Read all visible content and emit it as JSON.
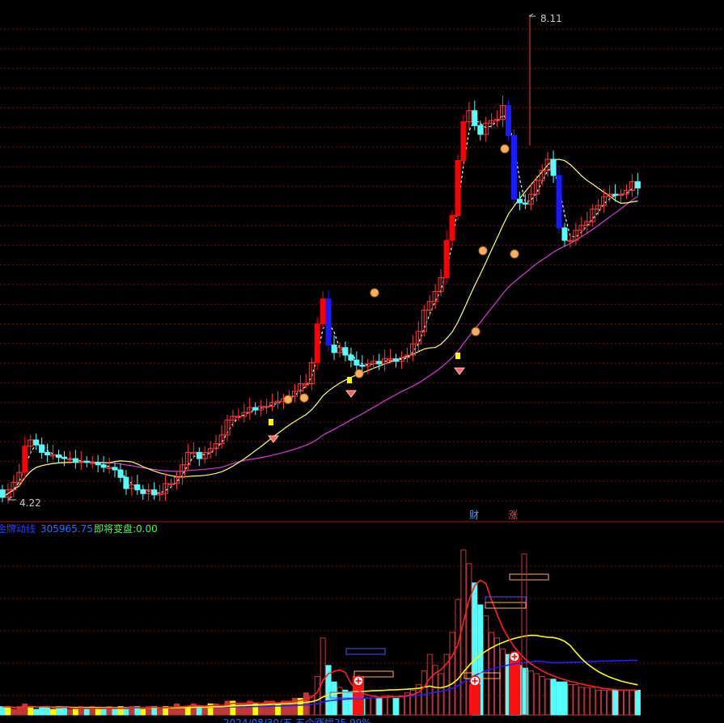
{
  "colors": {
    "background": "#000000",
    "grid": "#7a1010",
    "separator": "#a01818",
    "up": "#ff3b3b",
    "down": "#54ffff",
    "strong_up": "#ff0000",
    "strong_down": "#1a1aff",
    "price_trend": "#ffffff",
    "ma_short": "#ffff70",
    "ma_long": "#d040d0",
    "vol_ma_red": "#ff2020",
    "vol_ma_yellow": "#ffff00",
    "vol_ma_blue": "#2020ff",
    "text_gray": "#c8c8c8"
  },
  "main_chart": {
    "high_label": "8.11",
    "low_label": "4.22",
    "markers": [
      {
        "text": "财",
        "color": "#4a9dff"
      },
      {
        "text": "涨",
        "color": "#ff4040"
      }
    ]
  },
  "indicator": {
    "name": "金牌动线",
    "value": "305965.75",
    "label2": "即将变盘:",
    "value2": "0.00"
  },
  "bottom_text": "2024/08/30/五 五个涨幅25.99%",
  "chart_data": [
    {
      "type": "candlestick",
      "x": [
        0,
        1,
        2,
        3,
        4,
        5,
        6,
        7,
        8,
        9,
        10,
        11,
        12,
        13,
        14,
        15,
        16,
        17,
        18,
        19,
        20,
        21,
        22,
        23,
        24,
        25,
        26,
        27,
        28,
        29,
        30,
        31,
        32,
        33,
        34,
        35,
        36,
        37,
        38,
        39,
        40,
        41,
        42,
        43,
        44,
        45,
        46,
        47,
        48,
        49,
        50,
        51,
        52,
        53,
        54,
        55,
        56,
        57,
        58,
        59,
        60,
        61,
        62,
        63,
        64,
        65,
        66,
        67,
        68,
        69,
        70,
        71,
        72,
        73,
        74,
        75,
        76,
        77,
        78,
        79,
        80,
        81,
        82,
        83,
        84,
        85,
        86,
        87,
        88,
        89,
        90,
        91,
        92,
        93,
        94,
        95,
        96,
        97,
        98,
        99,
        100,
        101,
        102,
        103,
        104,
        105,
        106,
        107,
        108,
        109,
        110,
        111,
        112,
        113,
        114,
        115,
        116,
        117,
        118,
        119,
        120,
        121,
        122,
        123,
        124,
        125,
        126,
        127,
        128,
        129
      ],
      "open": [
        4.3,
        4.24,
        4.3,
        4.36,
        4.44,
        4.65,
        4.7,
        4.66,
        4.6,
        4.58,
        4.58,
        4.56,
        4.55,
        4.55,
        4.52,
        4.53,
        4.52,
        4.52,
        4.5,
        4.48,
        4.48,
        4.46,
        4.4,
        4.31,
        4.34,
        4.3,
        4.27,
        4.3,
        4.26,
        4.27,
        4.35,
        4.35,
        4.4,
        4.5,
        4.6,
        4.6,
        4.55,
        4.6,
        4.63,
        4.67,
        4.74,
        4.86,
        4.89,
        4.89,
        4.92,
        4.96,
        4.94,
        4.97,
        4.97,
        5.0,
        5.01,
        5.03,
        5.05,
        5.09,
        5.15,
        5.15,
        5.32,
        5.63,
        5.83,
        5.46,
        5.4,
        5.44,
        5.38,
        5.34,
        5.3,
        5.29,
        5.31,
        5.33,
        5.31,
        5.35,
        5.35,
        5.33,
        5.36,
        5.38,
        5.47,
        5.57,
        5.74,
        5.81,
        5.89,
        6.0,
        6.3,
        6.5,
        6.94,
        7.25,
        7.34,
        7.22,
        7.15,
        7.24,
        7.26,
        7.27,
        7.38,
        7.14,
        6.63,
        6.6,
        6.59,
        6.67,
        6.78,
        6.86,
        6.95,
        6.82,
        6.4,
        6.3,
        6.3,
        6.38,
        6.42,
        6.45,
        6.55,
        6.58,
        6.65,
        6.67,
        6.66,
        6.67,
        6.7,
        6.77
      ],
      "close": [
        4.24,
        4.3,
        4.36,
        4.44,
        4.65,
        4.7,
        4.66,
        4.6,
        4.58,
        4.58,
        4.56,
        4.55,
        4.55,
        4.52,
        4.53,
        4.52,
        4.52,
        4.5,
        4.48,
        4.48,
        4.46,
        4.4,
        4.31,
        4.34,
        4.3,
        4.27,
        4.3,
        4.26,
        4.27,
        4.35,
        4.35,
        4.4,
        4.5,
        4.6,
        4.6,
        4.55,
        4.6,
        4.63,
        4.67,
        4.74,
        4.86,
        4.89,
        4.89,
        4.92,
        4.96,
        4.94,
        4.97,
        4.97,
        5.0,
        5.01,
        5.03,
        5.05,
        5.09,
        5.15,
        5.15,
        5.32,
        5.63,
        5.83,
        5.46,
        5.4,
        5.44,
        5.38,
        5.34,
        5.3,
        5.29,
        5.31,
        5.33,
        5.31,
        5.35,
        5.35,
        5.33,
        5.36,
        5.38,
        5.47,
        5.57,
        5.74,
        5.81,
        5.89,
        6.0,
        6.3,
        6.5,
        6.94,
        7.25,
        7.34,
        7.22,
        7.15,
        7.24,
        7.26,
        7.27,
        7.38,
        7.14,
        6.63,
        6.6,
        6.59,
        6.67,
        6.78,
        6.86,
        6.95,
        6.82,
        6.4,
        6.3,
        6.3,
        6.38,
        6.42,
        6.45,
        6.55,
        6.58,
        6.65,
        6.67,
        6.66,
        6.67,
        6.7,
        6.77,
        6.72
      ],
      "note": "approximate daily OHLC read from the price panel; ranges from low 4.22 to high 8.11"
    },
    {
      "type": "bar",
      "name": "volume",
      "note": "relative volume bars in lower panel; largest bars around the 8.11 peak",
      "values": [
        3,
        3,
        2,
        3,
        4,
        3,
        2,
        3,
        3,
        2,
        3,
        3,
        2,
        2,
        3,
        2,
        3,
        2,
        2,
        3,
        2,
        3,
        2,
        3,
        3,
        2,
        3,
        3,
        2,
        3,
        3,
        4,
        3,
        3,
        4,
        3,
        3,
        4,
        4,
        3,
        5,
        5,
        4,
        4,
        5,
        4,
        4,
        5,
        5,
        4,
        5,
        5,
        6,
        6,
        8,
        7,
        14,
        28,
        18,
        12,
        10,
        9,
        8,
        7,
        6,
        6,
        7,
        6,
        7,
        7,
        6,
        7,
        8,
        9,
        11,
        16,
        22,
        18,
        15,
        22,
        30,
        42,
        60,
        55,
        48,
        40,
        36,
        30,
        28,
        24,
        22,
        20,
        18,
        17,
        16,
        15,
        14,
        13,
        13,
        12,
        12,
        11,
        11,
        10,
        10,
        10,
        9,
        9,
        9,
        9,
        9,
        9,
        9,
        9
      ]
    }
  ]
}
